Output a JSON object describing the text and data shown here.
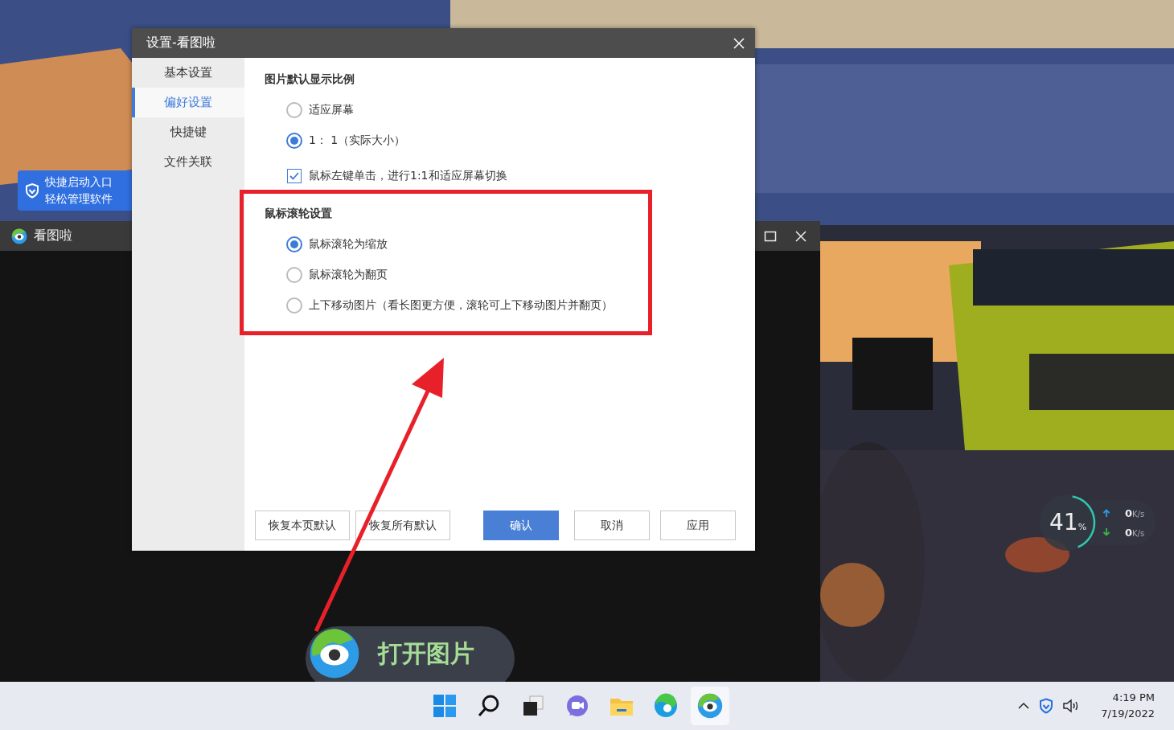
{
  "tooltip": {
    "lines": [
      "快捷启动入口",
      "轻松管理软件"
    ]
  },
  "app_window": {
    "title": "看图啦",
    "open_button": "打开图片"
  },
  "settings_dialog": {
    "title": "设置-看图啦",
    "nav": [
      {
        "label": "基本设置",
        "selected": false
      },
      {
        "label": "偏好设置",
        "selected": true
      },
      {
        "label": "快捷键",
        "selected": false
      },
      {
        "label": "文件关联",
        "selected": false
      }
    ],
    "sections": [
      {
        "title": "图片默认显示比例",
        "options": [
          {
            "kind": "radio",
            "label": "适应屏幕",
            "selected": false
          },
          {
            "kind": "radio",
            "label": "1： 1（实际大小）",
            "selected": true
          },
          {
            "kind": "checkbox",
            "label": "鼠标左键单击，进行1:1和适应屏幕切换",
            "checked": true
          }
        ]
      },
      {
        "title": "鼠标滚轮设置",
        "highlighted": true,
        "options": [
          {
            "kind": "radio",
            "label": "鼠标滚轮为缩放",
            "selected": true
          },
          {
            "kind": "radio",
            "label": "鼠标滚轮为翻页",
            "selected": false
          },
          {
            "kind": "radio",
            "label": "上下移动图片（看长图更方便，滚轮可上下移动图片并翻页）",
            "selected": false
          }
        ]
      }
    ],
    "buttons": [
      {
        "label": "恢复本页默认",
        "primary": false
      },
      {
        "label": "恢复所有默认",
        "primary": false
      },
      {
        "label": "确认",
        "primary": true
      },
      {
        "label": "取消",
        "primary": false
      },
      {
        "label": "应用",
        "primary": false
      }
    ]
  },
  "annotation": {
    "arrow": true
  },
  "net_meter": {
    "percent": "41",
    "unit": "%",
    "upload": "0",
    "upload_unit": "K/s",
    "download": "0",
    "download_unit": "K/s"
  },
  "taskbar": {
    "apps": [
      {
        "kind": "start",
        "active": false
      },
      {
        "kind": "search",
        "active": false
      },
      {
        "kind": "taskview",
        "active": false
      },
      {
        "kind": "chat",
        "active": false
      },
      {
        "kind": "explorer",
        "active": false
      },
      {
        "kind": "edge",
        "active": false
      },
      {
        "kind": "viewer",
        "active": true
      }
    ],
    "time": "4:19 PM",
    "date": "7/19/2022"
  }
}
